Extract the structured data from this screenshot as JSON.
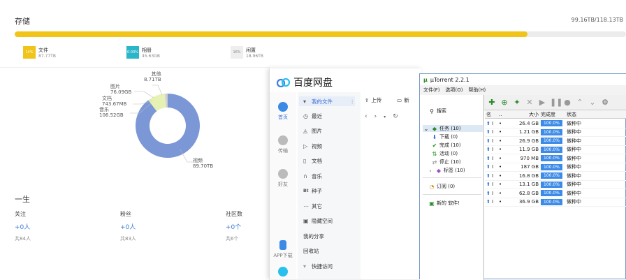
{
  "storage": {
    "title": "存储",
    "total": "99.16TB/118.13TB",
    "used_fraction": 0.839,
    "legend": [
      {
        "swatch": "14%",
        "name": "文件",
        "size": "87.77TB",
        "color": "#f0c419"
      },
      {
        "swatch": "0.03%",
        "name": "相册",
        "size": "45.63GB",
        "color": "#2bb5c9"
      },
      {
        "swatch": "16%",
        "name": "闲置",
        "size": "18.96TB",
        "color": "#eeeeee"
      }
    ]
  },
  "pie": {
    "labels": [
      {
        "name": "其他",
        "size": "8.71TB"
      },
      {
        "name": "图片",
        "size": "76.09GB"
      },
      {
        "name": "文档",
        "size": "743.67MB"
      },
      {
        "name": "音乐",
        "size": "106.52GB"
      },
      {
        "name": "视频",
        "size": "89.70TB"
      }
    ],
    "slices": [
      {
        "name": "视频",
        "value": 89.7,
        "color": "#7b97d6"
      },
      {
        "name": "其他",
        "value": 8.71,
        "color": "#e6f2b4"
      },
      {
        "name": "图片",
        "value": 0.8,
        "color": "#d7d7d7"
      },
      {
        "name": "音乐",
        "value": 0.8,
        "color": "#cccccc"
      }
    ]
  },
  "life": {
    "title": "一生",
    "stats": [
      {
        "label": "关注",
        "value": "+0人",
        "total": "共84人"
      },
      {
        "label": "粉丝",
        "value": "+0人",
        "total": "共83人"
      },
      {
        "label": "社区数",
        "value": "+0个",
        "total": "共6个"
      }
    ]
  },
  "baidu": {
    "title": "百度网盘",
    "nav": [
      {
        "label": "首页"
      },
      {
        "label": "传输"
      },
      {
        "label": "好友"
      },
      {
        "label": "APP下载"
      }
    ],
    "side": [
      {
        "label": "我的文件",
        "glyph": "▾"
      },
      {
        "label": "最近",
        "glyph": "◷"
      },
      {
        "label": "图片",
        "glyph": "◬"
      },
      {
        "label": "视频",
        "glyph": "▷"
      },
      {
        "label": "文档",
        "glyph": "▯"
      },
      {
        "label": "音乐",
        "glyph": "∩"
      },
      {
        "label": "种子",
        "glyph": "Bt"
      },
      {
        "label": "其它",
        "glyph": "⋯"
      },
      {
        "label": "隐藏空间",
        "glyph": "▣"
      },
      {
        "label": "我的分享",
        "glyph": ""
      },
      {
        "label": "回收站",
        "glyph": ""
      },
      {
        "label": "快捷访问",
        "glyph": "▾"
      }
    ],
    "upload": "上传",
    "new_prefix": "新"
  },
  "utorrent": {
    "title": "µTorrent 2.2.1",
    "menu": [
      "文件(F)",
      "选项(O)",
      "帮助(H)"
    ],
    "search": "搜索",
    "tree": [
      {
        "label": "任务 (10)",
        "color": "#2a8c2a"
      },
      {
        "label": "下载 (0)",
        "color": "#2a6fd0"
      },
      {
        "label": "完成 (10)",
        "color": "#1a9a1a"
      },
      {
        "label": "活动 (0)",
        "color": "#2a9a2a"
      },
      {
        "label": "停止 (10)",
        "color": "#888888"
      },
      {
        "label": "标签 (10)",
        "color": "#a050c0"
      }
    ],
    "feed": "订阅 (0)",
    "newsoft": "新的 软件!",
    "headers": {
      "name": "名",
      "dot": "..",
      "size": "大小",
      "done": "完成度",
      "status": "状态"
    },
    "rows": [
      {
        "size": "26.4 GB",
        "done": "100.0%",
        "status": "做种中"
      },
      {
        "size": "1.21 GB",
        "done": "100.0%",
        "status": "做种中"
      },
      {
        "size": "26.9 GB",
        "done": "100.0%",
        "status": "做种中"
      },
      {
        "size": "11.9 GB",
        "done": "100.0%",
        "status": "做种中"
      },
      {
        "size": "970 MB",
        "done": "100.0%",
        "status": "做种中"
      },
      {
        "size": "187 GB",
        "done": "100.0%",
        "status": "做种中"
      },
      {
        "size": "16.8 GB",
        "done": "100.0%",
        "status": "做种中"
      },
      {
        "size": "13.1 GB",
        "done": "100.0%",
        "status": "做种中"
      },
      {
        "size": "62.8 GB",
        "done": "100.0%",
        "status": "做种中"
      },
      {
        "size": "36.9 GB",
        "done": "100.0%",
        "status": "做种中"
      }
    ]
  }
}
